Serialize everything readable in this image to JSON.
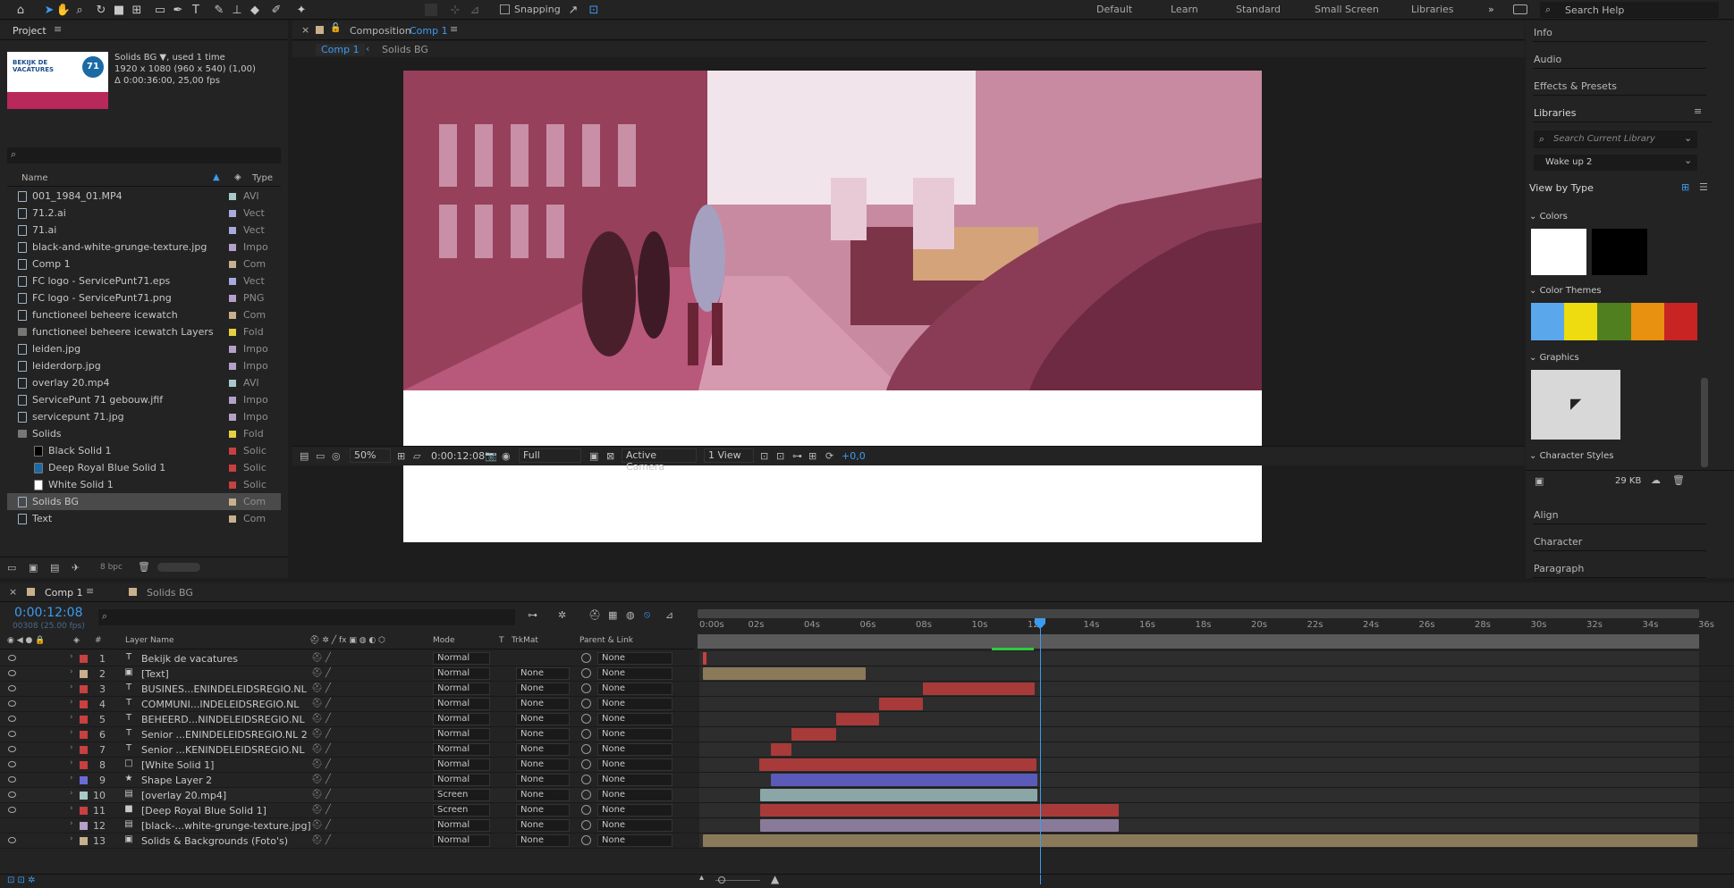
{
  "toolbar": {
    "snapping_label": "Snapping",
    "workspaces": [
      "Default",
      "Learn",
      "Standard",
      "Small Screen",
      "Libraries"
    ],
    "search_placeholder": "Search Help",
    "more": "»"
  },
  "project": {
    "tab": "Project",
    "thumb_text": "BEKIJK DE VACATURES",
    "thumb_badge": "71",
    "sel_name": "Solids BG",
    "sel_used": ", used 1 time",
    "sel_dims": "1920 x 1080  (960 x 540) (1,00)",
    "sel_dur": "Δ 0:00:36:00, 25,00 fps",
    "col_name": "Name",
    "col_type": "Type",
    "depth": "8 bpc",
    "items": [
      {
        "name": "001_1984_01.MP4",
        "type": "AVI",
        "color": "#a9c9c9"
      },
      {
        "name": "71.2.ai",
        "type": "Vect",
        "color": "#a9a9e0"
      },
      {
        "name": "71.ai",
        "type": "Vect",
        "color": "#a9a9e0"
      },
      {
        "name": "black-and-white-grunge-texture.jpg",
        "type": "Impo",
        "color": "#b4a0c8"
      },
      {
        "name": "Comp 1",
        "type": "Com",
        "color": "#c8b08c"
      },
      {
        "name": "FC logo - ServicePunt71.eps",
        "type": "Vect",
        "color": "#a9a9e0"
      },
      {
        "name": "FC logo - ServicePunt71.png",
        "type": "PNG",
        "color": "#b4a0c8"
      },
      {
        "name": "functioneel beheere icewatch",
        "type": "Com",
        "color": "#c8b08c"
      },
      {
        "name": "functioneel beheere icewatch Layers",
        "type": "Fold",
        "color": "#e6d040"
      },
      {
        "name": "leiden.jpg",
        "type": "Impo",
        "color": "#b4a0c8"
      },
      {
        "name": "leiderdorp.jpg",
        "type": "Impo",
        "color": "#b4a0c8"
      },
      {
        "name": "overlay 20.mp4",
        "type": "AVI",
        "color": "#a9c9c9"
      },
      {
        "name": "ServicePunt 71 gebouw.jfif",
        "type": "Impo",
        "color": "#b4a0c8"
      },
      {
        "name": "servicepunt 71.jpg",
        "type": "Impo",
        "color": "#b4a0c8"
      },
      {
        "name": "Solids",
        "type": "Fold",
        "color": "#e6d040"
      },
      {
        "name": "Black Solid 1",
        "type": "Solic",
        "color": "#c84040"
      },
      {
        "name": "Deep Royal Blue Solid 1",
        "type": "Solic",
        "color": "#c84040"
      },
      {
        "name": "White Solid 1",
        "type": "Solic",
        "color": "#c84040"
      },
      {
        "name": "Solids BG",
        "type": "Com",
        "color": "#c8b08c"
      },
      {
        "name": "Text",
        "type": "Com",
        "color": "#c8b08c"
      }
    ]
  },
  "composition": {
    "panel_title": "Composition",
    "comp_name": "Comp 1",
    "breadcrumb": [
      "Comp 1",
      "Solids BG"
    ],
    "zoom": "50%",
    "timecode": "0:00:12:08",
    "resolution": "Full",
    "camera": "Active Camera",
    "views": "1 View",
    "exposure": "+0,0"
  },
  "right_panel": {
    "top_items": [
      "Info",
      "Audio",
      "Effects & Presets"
    ],
    "libraries_title": "Libraries",
    "lib_search": "Search Current Library",
    "lib_name": "Wake up 2",
    "view_by": "View by Type",
    "colors_label": "Colors",
    "themes_label": "Color Themes",
    "graphics_label": "Graphics",
    "char_styles_label": "Character Styles",
    "size": "29 KB",
    "bottom_items": [
      "Align",
      "Character",
      "Paragraph"
    ],
    "theme_colors": [
      "#5aa7ec",
      "#eedc10",
      "#4f7f1e",
      "#e8900f",
      "#c82424"
    ]
  },
  "timeline": {
    "tabs": [
      "Comp 1",
      "Solids BG"
    ],
    "timecode": "0:00:12:08",
    "frame_info": "00308 (25.00 fps)",
    "col_layer": "Layer Name",
    "col_mode": "Mode",
    "col_t": "T",
    "col_trkmat": "TrkMat",
    "col_parent": "Parent & Link",
    "ruler": [
      "0:00s",
      "02s",
      "04s",
      "06s",
      "08s",
      "10s",
      "12s",
      "14s",
      "16s",
      "18s",
      "20s",
      "22s",
      "24s",
      "26s",
      "28s",
      "30s",
      "32s",
      "34s",
      "36s"
    ],
    "layers": [
      {
        "num": "1",
        "name": "Bekijk de vacatures",
        "icon": "T",
        "label": "#c84040",
        "mode": "Normal",
        "trk": "",
        "parent": "None"
      },
      {
        "num": "2",
        "name": "[Text]",
        "icon": "▣",
        "label": "#c8b08c",
        "mode": "Normal",
        "trk": "None",
        "parent": "None"
      },
      {
        "num": "3",
        "name": "BUSINES...ENINDELEIDSREGIO.NL",
        "icon": "T",
        "label": "#c84040",
        "mode": "Normal",
        "trk": "None",
        "parent": "None"
      },
      {
        "num": "4",
        "name": "COMMUNI...INDELEIDSREGIO.NL",
        "icon": "T",
        "label": "#c84040",
        "mode": "Normal",
        "trk": "None",
        "parent": "None"
      },
      {
        "num": "5",
        "name": "BEHEERD...NINDELEIDSREGIO.NL",
        "icon": "T",
        "label": "#c84040",
        "mode": "Normal",
        "trk": "None",
        "parent": "None"
      },
      {
        "num": "6",
        "name": "Senior ...ENINDELEIDSREGIO.NL 2",
        "icon": "T",
        "label": "#c84040",
        "mode": "Normal",
        "trk": "None",
        "parent": "None"
      },
      {
        "num": "7",
        "name": "Senior ...KENINDELEIDSREGIO.NL",
        "icon": "T",
        "label": "#c84040",
        "mode": "Normal",
        "trk": "None",
        "parent": "None"
      },
      {
        "num": "8",
        "name": "[White Solid 1]",
        "icon": "□",
        "label": "#c84040",
        "mode": "Normal",
        "trk": "None",
        "parent": "None"
      },
      {
        "num": "9",
        "name": "Shape Layer 2",
        "icon": "★",
        "label": "#6b6bd6",
        "mode": "Normal",
        "trk": "None",
        "parent": "None"
      },
      {
        "num": "10",
        "name": "[overlay 20.mp4]",
        "icon": "▤",
        "label": "#a9c9c9",
        "mode": "Screen",
        "trk": "None",
        "parent": "None"
      },
      {
        "num": "11",
        "name": "[Deep Royal Blue Solid 1]",
        "icon": "■",
        "label": "#c84040",
        "mode": "Screen",
        "trk": "None",
        "parent": "None"
      },
      {
        "num": "12",
        "name": "[black-...white-grunge-texture.jpg]",
        "icon": "▤",
        "label": "#b4a0c8",
        "mode": "Normal",
        "trk": "None",
        "parent": "None"
      },
      {
        "num": "13",
        "name": "Solids & Backgrounds (Foto's)",
        "icon": "▣",
        "label": "#c8b08c",
        "mode": "Normal",
        "trk": "None",
        "parent": "None"
      }
    ]
  }
}
